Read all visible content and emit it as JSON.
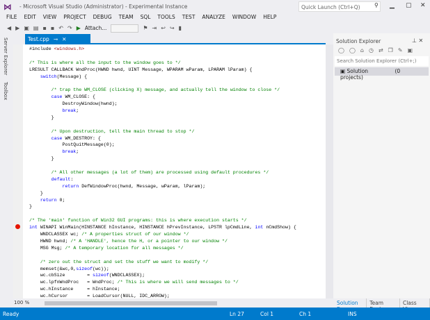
{
  "title": {
    "app_title": "- Microsoft Visual Studio (Administrator) - Experimental Instance",
    "quick_launch_placeholder": "Quick Launch (Ctrl+Q)"
  },
  "menu": [
    "FILE",
    "EDIT",
    "VIEW",
    "PROJECT",
    "DEBUG",
    "TEAM",
    "SQL",
    "TOOLS",
    "TEST",
    "ANALYZE",
    "WINDOW",
    "HELP"
  ],
  "toolbar": {
    "attach_label": "Attach..."
  },
  "side_tabs": [
    "Server Explorer",
    "Toolbox"
  ],
  "document_tab": {
    "label": "Test.cpp"
  },
  "code_lines": [
    [
      [
        "#include ",
        "tx"
      ],
      [
        "<windows.h>",
        "st"
      ]
    ],
    [],
    [
      [
        "/* This is where all the input to the window goes to */",
        "cm"
      ]
    ],
    [
      [
        "LRESULT CALLBACK WndProc(HWND hwnd, UINT Message, WPARAM wParam, LPARAM lParam) {",
        "tx"
      ]
    ],
    [
      [
        "    ",
        "tx"
      ],
      [
        "switch",
        "kw"
      ],
      [
        "(Message) {",
        "tx"
      ]
    ],
    [],
    [
      [
        "        /* trap the WM_CLOSE (clicking X) message, and actually tell the window to close */",
        "cm"
      ]
    ],
    [
      [
        "        ",
        "tx"
      ],
      [
        "case",
        "kw"
      ],
      [
        " WM_CLOSE: {",
        "tx"
      ]
    ],
    [
      [
        "            DestroyWindow(hwnd);",
        "tx"
      ]
    ],
    [
      [
        "            ",
        "tx"
      ],
      [
        "break",
        "kw"
      ],
      [
        ";",
        "tx"
      ]
    ],
    [
      [
        "        }",
        "tx"
      ]
    ],
    [],
    [
      [
        "        /* Upon destruction, tell the main thread to stop */",
        "cm"
      ]
    ],
    [
      [
        "        ",
        "tx"
      ],
      [
        "case",
        "kw"
      ],
      [
        " WM_DESTROY: {",
        "tx"
      ]
    ],
    [
      [
        "            PostQuitMessage(0);",
        "tx"
      ]
    ],
    [
      [
        "            ",
        "tx"
      ],
      [
        "break",
        "kw"
      ],
      [
        ";",
        "tx"
      ]
    ],
    [
      [
        "        }",
        "tx"
      ]
    ],
    [],
    [
      [
        "        /* All other messages (a lot of them) are processed using default procedures */",
        "cm"
      ]
    ],
    [
      [
        "        ",
        "tx"
      ],
      [
        "default",
        "kw"
      ],
      [
        ":",
        "tx"
      ]
    ],
    [
      [
        "            ",
        "tx"
      ],
      [
        "return",
        "kw"
      ],
      [
        " DefWindowProc(hwnd, Message, wParam, lParam);",
        "tx"
      ]
    ],
    [
      [
        "    }",
        "tx"
      ]
    ],
    [
      [
        "    ",
        "tx"
      ],
      [
        "return",
        "kw"
      ],
      [
        " 0;",
        "tx"
      ]
    ],
    [
      [
        "}",
        "tx"
      ]
    ],
    [],
    [
      [
        "/* The 'main' function of Win32 GUI programs: this is where execution starts */",
        "cm"
      ]
    ],
    [
      [
        "int",
        "kw"
      ],
      [
        " WINAPI WinMain(HINSTANCE hInstance, HINSTANCE hPrevInstance, LPSTR lpCmdLine, ",
        "tx"
      ],
      [
        "int",
        "kw"
      ],
      [
        " nCmdShow) {",
        "tx"
      ]
    ],
    [
      [
        "    WNDCLASSEX wc; ",
        "tx"
      ],
      [
        "/* A properties struct of our window */",
        "cm"
      ]
    ],
    [
      [
        "    HWND hwnd; ",
        "tx"
      ],
      [
        "/* A 'HANDLE', hence the H, or a pointer to our window */",
        "cm"
      ]
    ],
    [
      [
        "    MSG Msg; ",
        "tx"
      ],
      [
        "/* A temporary location for all messages */",
        "cm"
      ]
    ],
    [],
    [
      [
        "    /* zero out the struct and set the stuff we want to modify */",
        "cm"
      ]
    ],
    [
      [
        "    memset(&wc,0,",
        "tx"
      ],
      [
        "sizeof",
        "kw"
      ],
      [
        "(wc));",
        "tx"
      ]
    ],
    [
      [
        "    wc.cbSize        = ",
        "tx"
      ],
      [
        "sizeof",
        "kw"
      ],
      [
        "(WNDCLASSEX);",
        "tx"
      ]
    ],
    [
      [
        "    wc.lpfnWndProc   = WndProc; ",
        "tx"
      ],
      [
        "/* This is where we will send messages to */",
        "cm"
      ]
    ],
    [
      [
        "    wc.hInstance     = hInstance;",
        "tx"
      ]
    ],
    [
      [
        "    wc.hCursor       = LoadCursor(NULL, IDC_ARROW);",
        "tx"
      ]
    ]
  ],
  "editor": {
    "zoom": "100 %"
  },
  "solution_explorer": {
    "title": "Solution Explorer",
    "search_placeholder": "Search Solution Explorer (Ctrl+;)",
    "root_label": "Solution",
    "root_suffix": "(0 projects)",
    "tabs": [
      "Solution E...",
      "Team Expl...",
      "Class View"
    ]
  },
  "status": {
    "text": "Ready",
    "ln": "Ln 27",
    "col": "Col 1",
    "ch": "Ch 1",
    "mode": "INS"
  },
  "colors": {
    "accent": "#007acc",
    "keyword": "#0000ff",
    "comment": "#008000",
    "string": "#a31515",
    "breakpoint": "#e51400"
  }
}
